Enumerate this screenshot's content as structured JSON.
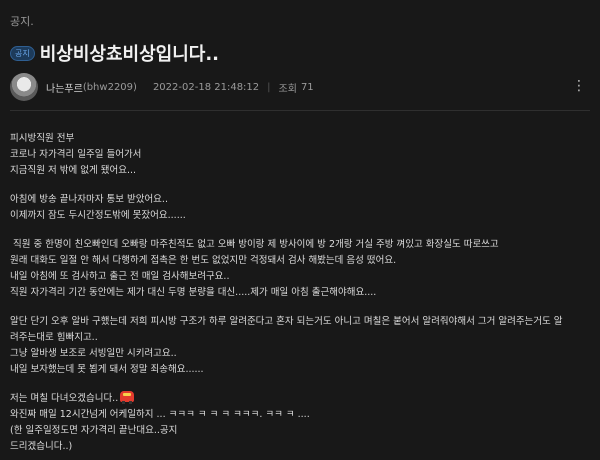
{
  "category": "공지.",
  "post": {
    "badge": "공지",
    "title": "비상비상쵸비상입니다..",
    "author": "나는푸르",
    "handle": "(bhw2209)",
    "date": "2022-02-18 21:48:12",
    "views_label": "조회",
    "views": "71"
  },
  "icons": {
    "more": "more-vert-icon",
    "avatar": "avatar-image",
    "emoji": "car-emoji"
  },
  "colors": {
    "background": "#181818",
    "badge_text": "#6aa6e8",
    "badge_bg": "#1d3b5b"
  },
  "body": {
    "p1": [
      "피시방직원 전부",
      "코로나 자가격리 일주일 들어가서",
      "지금직원 저 밖에 없게 됐어요..."
    ],
    "p2": [
      "아침에 방송 끝나자마자 통보 받았어요..",
      "이제까지 잠도 두시간정도밖에 못잤어요......"
    ],
    "p3": [
      " 직원 중 한명이 친오빠인데 오빠랑 마주친적도 없고 오빠 방이랑 제 방사이에 방 2개랑 거실 주방 껴있고 화장실도 따로쓰고",
      "원래 대화도 일절 안 해서 다행하게 접촉은 한 번도 없었지만 걱정돼서 검사 해봤는데 음성 떴어요.",
      "내일 아침에 또 검사하고 출근 전 매일 검사해보려구요..",
      "직원 자가격리 기간 동안에는 제가 대신 두명 분량을 대신.....제가 매일 아침 출근해야해요...."
    ],
    "p4": [
      "알단 단기 오후 알바 구했는데 저희 피시방 구조가 하루 알려준다고 혼자 되는거도 아니고 며칠은 붙어서 알려줘야해서 그거 알려주는거도 알",
      "려주는대로 힘빠지고..",
      "그냥 알바생 보조로 서빙일만 시키려고요..",
      "내일 보자했는데 못 뵙게 돼서 정말 죄송해요......"
    ],
    "p5": [
      "저는 며칠 다녀오겠습니다..",
      "와진짜 매일 12시간넘게 어케일하지 ... ㅋㅋㅋ ㅋ ㅋ ㅋ ㅋㅋㅋ. ㅋㅋ ㅋ ....",
      "(한 일주일정도면 자가격리 끝난대요..공지",
      "드리겠습니다..)"
    ]
  }
}
